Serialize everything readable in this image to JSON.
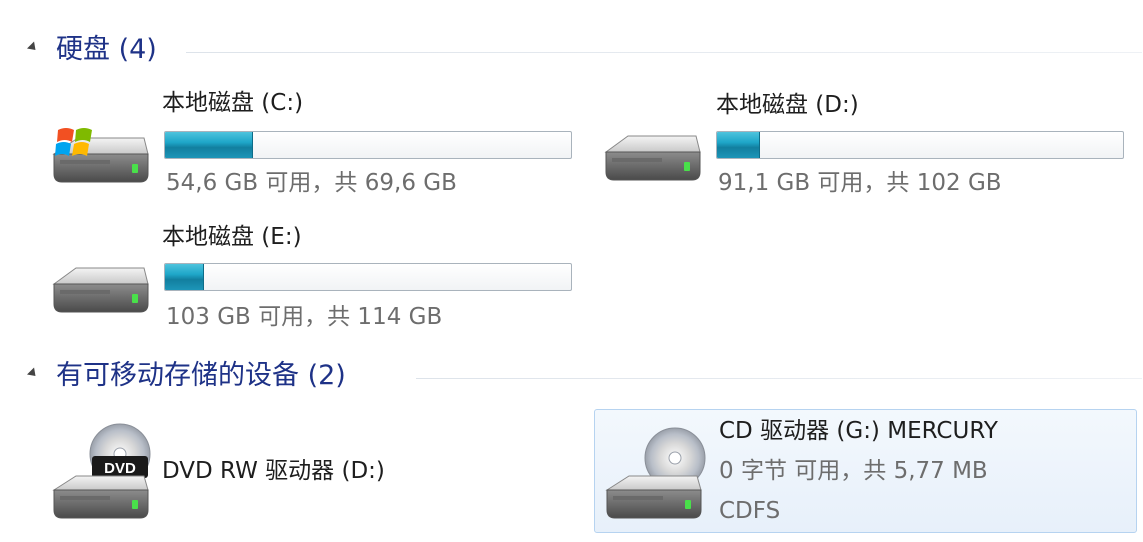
{
  "hard_disks": {
    "title": "硬盘 (4)",
    "drives": [
      {
        "name": "本地磁盘 (C:)",
        "free_text": "54,6 GB 可用，共 69,6 GB",
        "used_fraction": 0.216,
        "icon": "windows-system-drive-icon"
      },
      {
        "name": "本地磁盘 (D:)",
        "free_text": "91,1 GB 可用，共 102 GB",
        "used_fraction": 0.107,
        "icon": "hard-drive-icon"
      },
      {
        "name": "本地磁盘 (E:)",
        "free_text": "103 GB 可用，共 114 GB",
        "used_fraction": 0.096,
        "icon": "hard-drive-icon"
      }
    ]
  },
  "removable": {
    "title": "有可移动存储的设备 (2)",
    "devices": [
      {
        "name": "DVD RW 驱动器 (D:)",
        "icon": "dvd-drive-icon",
        "icon_label": "DVD"
      },
      {
        "name": "CD 驱动器 (G:) MERCURY",
        "free_text": "0 字节 可用，共 5,77 MB",
        "fs": "CDFS",
        "icon": "cd-drive-icon",
        "selected": true
      }
    ]
  },
  "colors": {
    "section_title": "#1e3287",
    "bar_fill": "#1ea6c8",
    "selection_border": "#b6d3f0"
  }
}
